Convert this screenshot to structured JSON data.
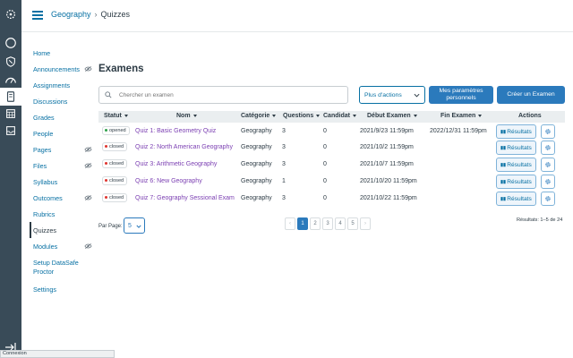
{
  "header": {
    "course": "Geography",
    "separator": "›",
    "current": "Quizzes"
  },
  "global_nav": {
    "icons": [
      "logo-icon",
      "account-icon",
      "admin-shield-icon",
      "dashboard-icon",
      "courses-icon",
      "calendar-icon",
      "inbox-icon"
    ],
    "active": "courses-icon"
  },
  "course_nav": {
    "items": [
      {
        "label": "Home",
        "hidden": false,
        "active": false
      },
      {
        "label": "Announcements",
        "hidden": true,
        "active": false
      },
      {
        "label": "Assignments",
        "hidden": false,
        "active": false
      },
      {
        "label": "Discussions",
        "hidden": false,
        "active": false
      },
      {
        "label": "Grades",
        "hidden": false,
        "active": false
      },
      {
        "label": "People",
        "hidden": false,
        "active": false
      },
      {
        "label": "Pages",
        "hidden": true,
        "active": false
      },
      {
        "label": "Files",
        "hidden": true,
        "active": false
      },
      {
        "label": "Syllabus",
        "hidden": false,
        "active": false
      },
      {
        "label": "Outcomes",
        "hidden": true,
        "active": false
      },
      {
        "label": "Rubrics",
        "hidden": false,
        "active": false
      },
      {
        "label": "Quizzes",
        "hidden": false,
        "active": true
      },
      {
        "label": "Modules",
        "hidden": true,
        "active": false
      },
      {
        "label": "Setup DataSafe Proctor",
        "hidden": false,
        "active": false
      },
      {
        "label": "Settings",
        "hidden": false,
        "active": false
      }
    ]
  },
  "main": {
    "title": "Examens",
    "search_placeholder": "Chercher un examen",
    "more_actions": "Plus d'actions",
    "my_settings": "Mes paramètres personnels",
    "create_exam": "Créer un Examen"
  },
  "table": {
    "columns": {
      "status": "Statut",
      "name": "Nom",
      "category": "Catégorie",
      "questions": "Questions",
      "candidates": "Candidat",
      "start": "Début Examen",
      "end": "Fin Examen",
      "actions": "Actions"
    },
    "results_label": "Résultats",
    "rows": [
      {
        "status": "opened",
        "name": "Quiz 1: Basic Geometry Quiz",
        "category": "Geography",
        "questions": "3",
        "candidates": "0",
        "start": "2021/9/23 11:59pm",
        "end": "2022/12/31 11:59pm"
      },
      {
        "status": "closed",
        "name": "Quiz 2: North American Geography",
        "category": "Geography",
        "questions": "3",
        "candidates": "0",
        "start": "2021/10/2 11:59pm",
        "end": ""
      },
      {
        "status": "closed",
        "name": "Quiz 3: Arithmetic Geography",
        "category": "Geography",
        "questions": "3",
        "candidates": "0",
        "start": "2021/10/7 11:59pm",
        "end": ""
      },
      {
        "status": "closed",
        "name": "Quiz 6: New Geography",
        "category": "Geography",
        "questions": "1",
        "candidates": "0",
        "start": "2021/10/20 11:59pm",
        "end": ""
      },
      {
        "status": "closed",
        "name": "Quiz 7: Geography Sessional Exam",
        "category": "Geography",
        "questions": "3",
        "candidates": "0",
        "start": "2021/10/22 11:59pm",
        "end": ""
      }
    ]
  },
  "pagination": {
    "per_page_label": "Par Page:",
    "per_page": "5",
    "prev": "‹",
    "next": "›",
    "pages": [
      "1",
      "2",
      "3",
      "4",
      "5"
    ],
    "current_page": "1",
    "results": "Résultats: 1–5 de 24"
  },
  "status_bar": "Connexion",
  "colors": {
    "nav_bg": "#394b58",
    "link": "#0770a3",
    "primary": "#2b7abc",
    "quiz_link": "#7b3fb2",
    "opened": "#2fa14a",
    "closed": "#e0342f"
  }
}
